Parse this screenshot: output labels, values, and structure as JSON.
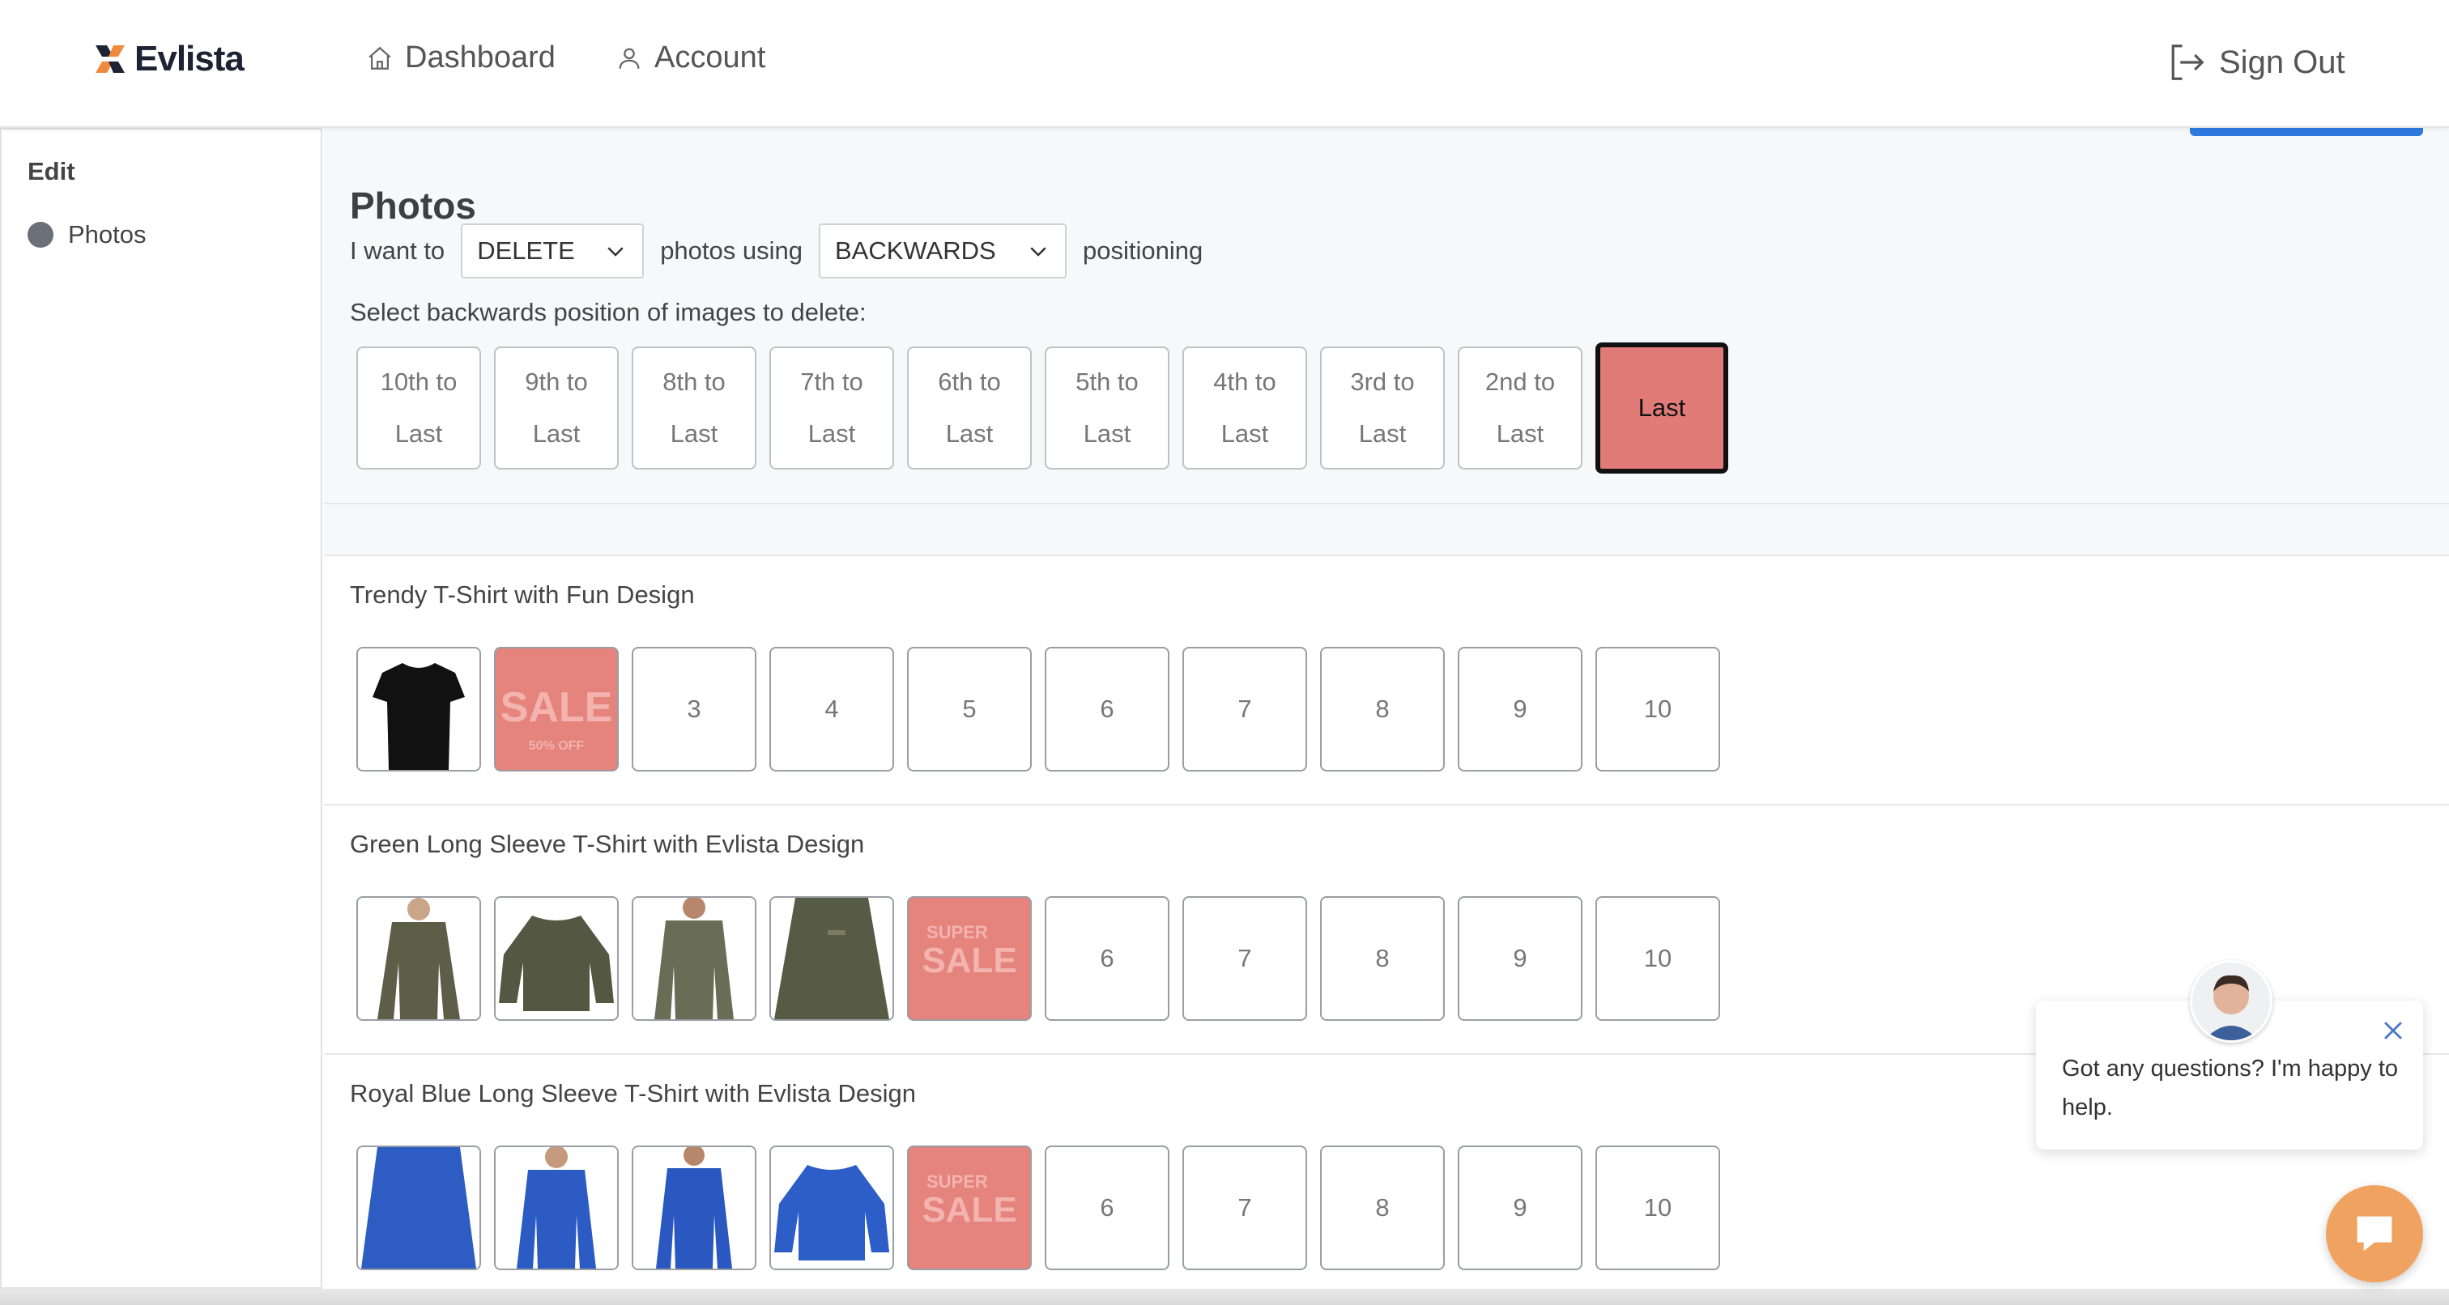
{
  "brand": {
    "name": "Evlista"
  },
  "nav": {
    "dashboard": "Dashboard",
    "account": "Account",
    "sign_out": "Sign Out"
  },
  "sidebar": {
    "title": "Edit",
    "items": [
      {
        "label": "Photos",
        "icon": "circle-dot-icon"
      }
    ]
  },
  "photos": {
    "title": "Photos",
    "sentence": {
      "prefix": "I want to",
      "operation": "DELETE",
      "middle": "photos using",
      "mode": "BACKWARDS",
      "suffix": "positioning"
    },
    "instruction": "Select backwards position of images to delete:",
    "positions": [
      {
        "line1": "10th to",
        "line2": "Last"
      },
      {
        "line1": "9th to",
        "line2": "Last"
      },
      {
        "line1": "8th to",
        "line2": "Last"
      },
      {
        "line1": "7th to",
        "line2": "Last"
      },
      {
        "line1": "6th to",
        "line2": "Last"
      },
      {
        "line1": "5th to",
        "line2": "Last"
      },
      {
        "line1": "4th to",
        "line2": "Last"
      },
      {
        "line1": "3rd to",
        "line2": "Last"
      },
      {
        "line1": "2nd to",
        "line2": "Last"
      },
      {
        "line1": "Last",
        "line2": ""
      }
    ],
    "selected_position": "Last",
    "selected_color": "#e07b78"
  },
  "products": [
    {
      "title": "Trendy T-Shirt with Fun Design",
      "slots": [
        {
          "type": "image",
          "image": "black-tshirt"
        },
        {
          "type": "image",
          "image": "sale-banner",
          "text": "SALE",
          "subtext": "50% OFF"
        },
        {
          "type": "empty",
          "label": "3"
        },
        {
          "type": "empty",
          "label": "4"
        },
        {
          "type": "empty",
          "label": "5"
        },
        {
          "type": "empty",
          "label": "6"
        },
        {
          "type": "empty",
          "label": "7"
        },
        {
          "type": "empty",
          "label": "8"
        },
        {
          "type": "empty",
          "label": "9"
        },
        {
          "type": "empty",
          "label": "10"
        }
      ]
    },
    {
      "title": "Green Long Sleeve T-Shirt with Evlista Design",
      "slots": [
        {
          "type": "image",
          "image": "green-longsleeve-model"
        },
        {
          "type": "image",
          "image": "green-longsleeve-flat"
        },
        {
          "type": "image",
          "image": "green-longsleeve-model"
        },
        {
          "type": "image",
          "image": "green-longsleeve-closeup"
        },
        {
          "type": "image",
          "image": "super-sale-banner",
          "text_top": "SUPER",
          "text": "SALE"
        },
        {
          "type": "empty",
          "label": "6"
        },
        {
          "type": "empty",
          "label": "7"
        },
        {
          "type": "empty",
          "label": "8"
        },
        {
          "type": "empty",
          "label": "9"
        },
        {
          "type": "empty",
          "label": "10"
        }
      ]
    },
    {
      "title": "Royal Blue Long Sleeve T-Shirt with Evlista Design",
      "slots": [
        {
          "type": "image",
          "image": "blue-longsleeve-closeup"
        },
        {
          "type": "image",
          "image": "blue-longsleeve-model"
        },
        {
          "type": "image",
          "image": "blue-longsleeve-model"
        },
        {
          "type": "image",
          "image": "blue-longsleeve-flat"
        },
        {
          "type": "image",
          "image": "super-sale-banner",
          "text_top": "SUPER",
          "text": "SALE"
        },
        {
          "type": "empty",
          "label": "6"
        },
        {
          "type": "empty",
          "label": "7"
        },
        {
          "type": "empty",
          "label": "8"
        },
        {
          "type": "empty",
          "label": "9"
        },
        {
          "type": "empty",
          "label": "10"
        }
      ]
    }
  ],
  "chat": {
    "message": "Got any questions? I'm happy to help."
  },
  "colors": {
    "accent_blue": "#2f7ae0",
    "sale_red": "#e5837d",
    "chat_orange": "#f0a361"
  }
}
